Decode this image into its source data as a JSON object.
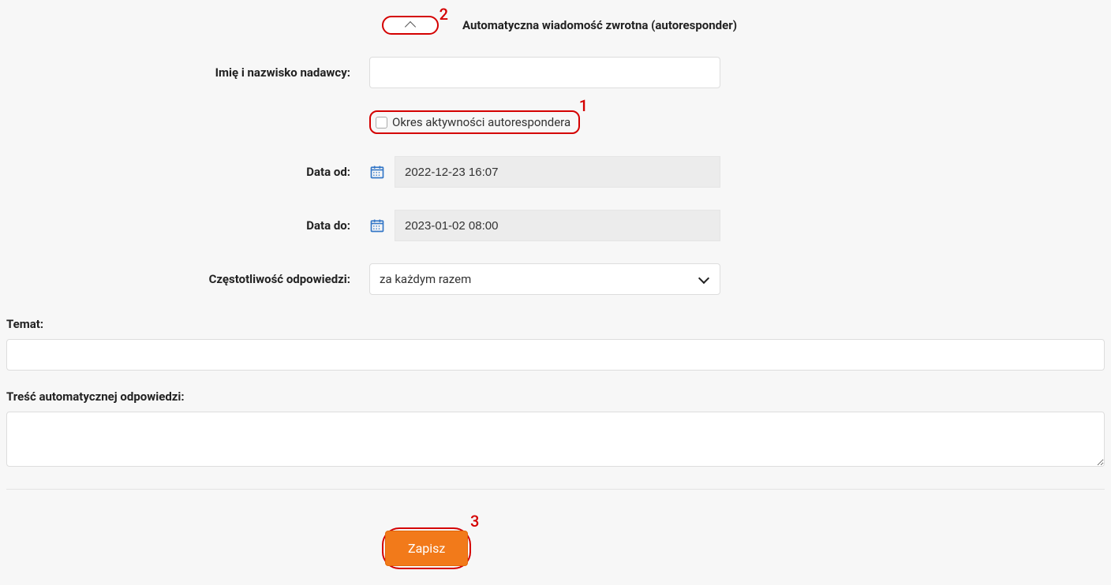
{
  "annotations": {
    "one": "1",
    "two": "2",
    "three": "3"
  },
  "section": {
    "title": "Automatyczna wiadomość zwrotna (autoresponder)"
  },
  "labels": {
    "sender_name": "Imię i nazwisko nadawcy:",
    "activity_period": "Okres aktywności autorespondera",
    "date_from": "Data od:",
    "date_to": "Data do:",
    "frequency": "Częstotliwość odpowiedzi:",
    "subject": "Temat:",
    "body": "Treść automatycznej odpowiedzi:"
  },
  "values": {
    "sender_name": "",
    "activity_period_checked": false,
    "date_from": "2022-12-23 16:07",
    "date_to": "2023-01-02 08:00",
    "frequency_selected": "za każdym razem",
    "subject": "",
    "body": ""
  },
  "buttons": {
    "save": "Zapisz"
  }
}
